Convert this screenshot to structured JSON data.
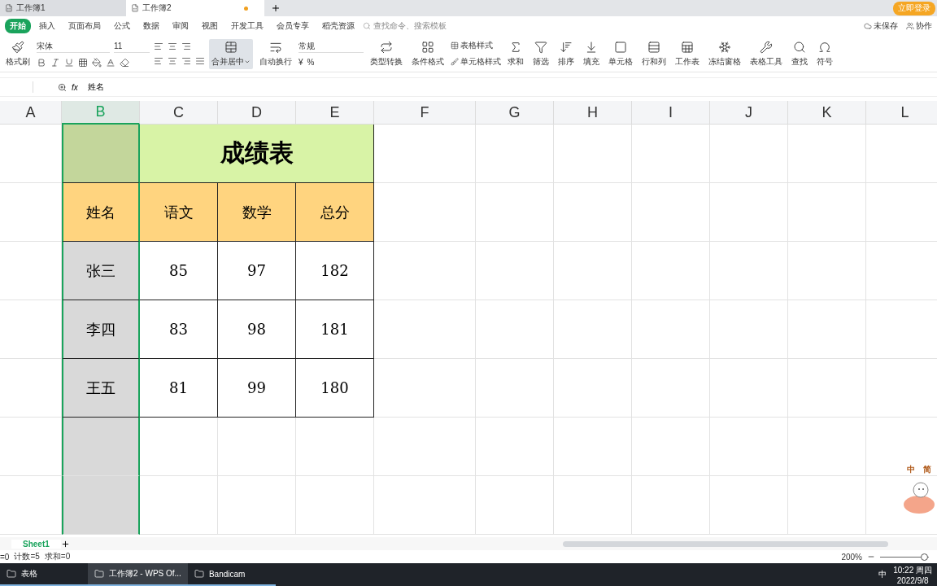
{
  "doc_tabs": [
    {
      "label": "工作簿1",
      "selected": false
    },
    {
      "label": "工作簿2",
      "selected": true
    }
  ],
  "login_button": "立即登录",
  "menu": [
    {
      "label": "开始",
      "selected": true
    },
    {
      "label": "插入",
      "selected": false
    },
    {
      "label": "页面布局",
      "selected": false
    },
    {
      "label": "公式",
      "selected": false
    },
    {
      "label": "数据",
      "selected": false
    },
    {
      "label": "审阅",
      "selected": false
    },
    {
      "label": "视图",
      "selected": false
    },
    {
      "label": "开发工具",
      "selected": false
    },
    {
      "label": "会员专享",
      "selected": false
    },
    {
      "label": "稻壳资源",
      "selected": false
    }
  ],
  "search": {
    "placeholder": "查找命令、搜索模板"
  },
  "save_status": "未保存",
  "collab": "协作",
  "font": {
    "name": "宋体",
    "size": "11"
  },
  "number_format": "常规",
  "ribbon_left": [
    {
      "label": "格式刷"
    }
  ],
  "ribbon_mid": [
    {
      "label": "合并居中",
      "dropdown": true,
      "active": true
    },
    {
      "label": "自动换行",
      "dropdown": false,
      "active": false
    }
  ],
  "ribbon_right": [
    {
      "label": "类型转换"
    },
    {
      "label": "条件格式"
    }
  ],
  "style_buttons": [
    {
      "label": "表格样式"
    },
    {
      "label": "单元格样式"
    }
  ],
  "ribbon_tools": [
    {
      "label": "求和"
    },
    {
      "label": "筛选"
    },
    {
      "label": "排序"
    },
    {
      "label": "填充"
    },
    {
      "label": "单元格"
    },
    {
      "label": "行和列"
    },
    {
      "label": "工作表"
    },
    {
      "label": "冻结窗格"
    },
    {
      "label": "表格工具"
    },
    {
      "label": "查找"
    },
    {
      "label": "符号"
    }
  ],
  "number_symbols": [
    "¥",
    "%"
  ],
  "formula_bar": {
    "fx": "fx",
    "value": "姓名"
  },
  "zoom_slider": {
    "level": 0.9
  },
  "columns": [
    {
      "label": "A",
      "selected": false
    },
    {
      "label": "B",
      "selected": true
    },
    {
      "label": "C",
      "selected": false
    },
    {
      "label": "D",
      "selected": false
    },
    {
      "label": "E",
      "selected": false
    },
    {
      "label": "F",
      "selected": false
    },
    {
      "label": "G",
      "selected": false
    },
    {
      "label": "H",
      "selected": false
    },
    {
      "label": "I",
      "selected": false
    },
    {
      "label": "J",
      "selected": false
    },
    {
      "label": "K",
      "selected": false
    },
    {
      "label": "L",
      "selected": false
    }
  ],
  "sheet": {
    "title": "成绩表",
    "headers": [
      "姓名",
      "语文",
      "数学",
      "总分"
    ],
    "records": [
      {
        "name": "张三",
        "values": [
          "85",
          "97",
          "182"
        ]
      },
      {
        "name": "李四",
        "values": [
          "83",
          "98",
          "181"
        ]
      },
      {
        "name": "王五",
        "values": [
          "81",
          "99",
          "180"
        ]
      }
    ]
  },
  "sheet_tabs": [
    {
      "label": "Sheet1",
      "selected": true
    }
  ],
  "status": [
    "=0",
    "计数=5",
    "求和=0"
  ],
  "zoom": "200%",
  "mascot": [
    "中",
    "简"
  ],
  "taskbar": [
    {
      "label": "表格",
      "selected": false
    },
    {
      "label": "工作簿2 - WPS Of...",
      "selected": true
    },
    {
      "label": "Bandicam",
      "selected": false
    }
  ],
  "tray": {
    "ime": "中",
    "time": "10:22 周四",
    "date": "2022/9/8"
  }
}
